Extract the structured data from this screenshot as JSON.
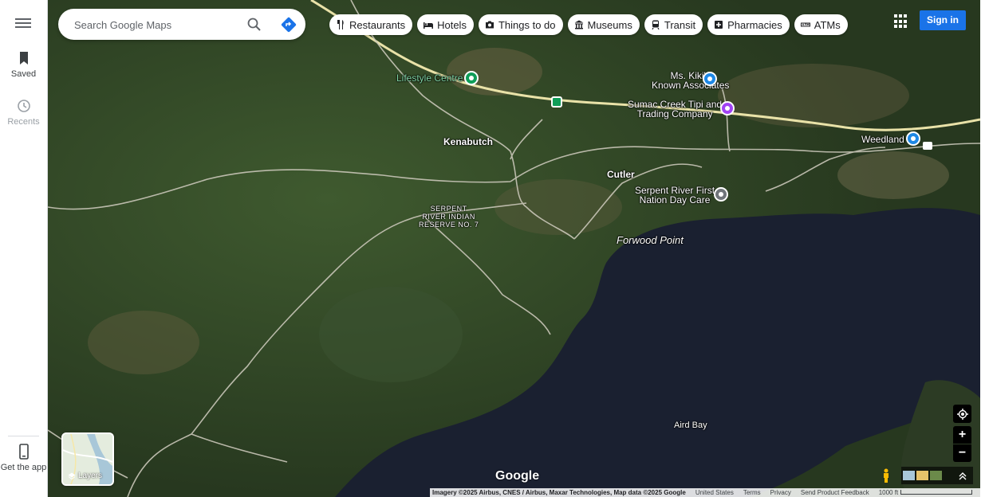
{
  "search": {
    "placeholder": "Search Google Maps"
  },
  "rail": {
    "saved": "Saved",
    "recents": "Recents",
    "get_app": "Get the app"
  },
  "chips": [
    {
      "label": "Restaurants",
      "icon": "fork-knife-icon"
    },
    {
      "label": "Hotels",
      "icon": "bed-icon"
    },
    {
      "label": "Things to do",
      "icon": "camera-icon"
    },
    {
      "label": "Museums",
      "icon": "museum-icon"
    },
    {
      "label": "Transit",
      "icon": "train-icon"
    },
    {
      "label": "Pharmacies",
      "icon": "pharmacy-icon"
    },
    {
      "label": "ATMs",
      "icon": "atm-icon"
    }
  ],
  "header": {
    "sign_in": "Sign in"
  },
  "map_labels": {
    "lifestyle": "Lifestyle Centre",
    "kikis_1": "Ms. Kiki's",
    "kikis_2": "Known Associates",
    "sumac_1": "Sumac Creek Tipi and",
    "sumac_2": "Trading Company",
    "weedland": "Weedland",
    "kenabutch": "Kenabutch",
    "cutler": "Cutler",
    "serpent_1": "Serpent River First",
    "serpent_2": "Nation Day Care",
    "reserve_1": "SERPENT",
    "reserve_2": "RIVER INDIAN",
    "reserve_3": "RESERVE NO. 7",
    "forwood": "Forwood Point",
    "aird": "Aird Bay"
  },
  "layers": {
    "label": "Layers"
  },
  "brand": {
    "google": "Google"
  },
  "footer": {
    "imagery": "Imagery ©2025 Airbus, CNES / Airbus, Maxar Technologies, Map data ©2025 Google",
    "country": "United States",
    "terms": "Terms",
    "privacy": "Privacy",
    "feedback": "Send Product Feedback",
    "scale": "1000 ft"
  },
  "controls": {
    "zoom_in": "+",
    "zoom_out": "−"
  },
  "colors": {
    "forest": "#2f4326",
    "water": "#1a2030",
    "road": "#c9c6b8",
    "highway": "#e9e2a8",
    "accent": "#1a73e8",
    "pin_blue": "#1e88e5",
    "pin_purple": "#a142f4",
    "pin_green": "#0f9d58",
    "pin_gray": "#70757a"
  }
}
